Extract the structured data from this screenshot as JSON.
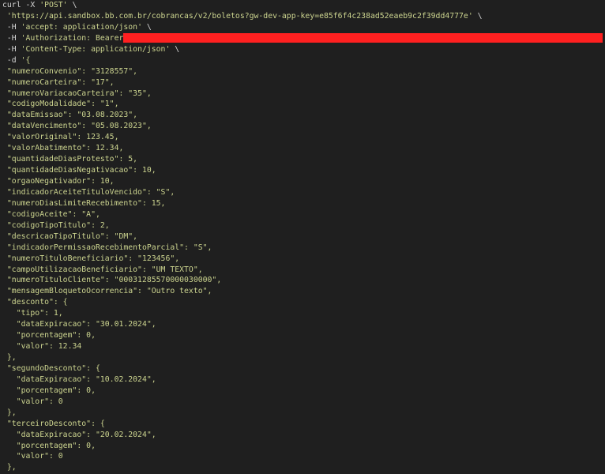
{
  "colors": {
    "background": "#1f1f1f",
    "plain_text": "#d4d4d4",
    "string": "#ccd48f",
    "redaction": "#ff2020"
  },
  "lines": [
    {
      "indent": 0,
      "parts": [
        {
          "t": "curl -X ",
          "c": "w"
        },
        {
          "t": "'POST'",
          "c": "s"
        },
        {
          "t": " \\",
          "c": "w"
        }
      ]
    },
    {
      "indent": 1,
      "parts": [
        {
          "t": "'https://api.sandbox.bb.com.br/cobrancas/v2/boletos?gw-dev-app-key=e85f6f4c238ad52eaeb9c2f39dd4777e'",
          "c": "s"
        },
        {
          "t": " \\",
          "c": "w"
        }
      ]
    },
    {
      "indent": 1,
      "parts": [
        {
          "t": "-H ",
          "c": "w"
        },
        {
          "t": "'accept: application/json'",
          "c": "s"
        },
        {
          "t": " \\",
          "c": "w"
        }
      ]
    },
    {
      "indent": 1,
      "parts": [
        {
          "t": "-H ",
          "c": "w"
        },
        {
          "t": "'Authorization: Bearer ",
          "c": "s"
        }
      ]
    },
    {
      "indent": 1,
      "parts": [
        {
          "t": "-H ",
          "c": "w"
        },
        {
          "t": "'Content-Type: application/json'",
          "c": "s"
        },
        {
          "t": " \\",
          "c": "w"
        }
      ]
    },
    {
      "indent": 1,
      "parts": [
        {
          "t": "-d ",
          "c": "w"
        },
        {
          "t": "'{",
          "c": "s"
        }
      ]
    },
    {
      "indent": 1,
      "parts": [
        {
          "t": "\"numeroConvenio\": \"3128557\",",
          "c": "s"
        }
      ]
    },
    {
      "indent": 1,
      "parts": [
        {
          "t": "\"numeroCarteira\": \"17\",",
          "c": "s"
        }
      ]
    },
    {
      "indent": 1,
      "parts": [
        {
          "t": "\"numeroVariacaoCarteira\": \"35\",",
          "c": "s"
        }
      ]
    },
    {
      "indent": 1,
      "parts": [
        {
          "t": "\"codigoModalidade\": \"1\",",
          "c": "s"
        }
      ]
    },
    {
      "indent": 1,
      "parts": [
        {
          "t": "\"dataEmissao\": \"03.08.2023\",",
          "c": "s"
        }
      ]
    },
    {
      "indent": 1,
      "parts": [
        {
          "t": "\"dataVencimento\": \"05.08.2023\",",
          "c": "s"
        }
      ]
    },
    {
      "indent": 1,
      "parts": [
        {
          "t": "\"valorOriginal\": 123.45,",
          "c": "s"
        }
      ]
    },
    {
      "indent": 1,
      "parts": [
        {
          "t": "\"valorAbatimento\": 12.34,",
          "c": "s"
        }
      ]
    },
    {
      "indent": 1,
      "parts": [
        {
          "t": "\"quantidadeDiasProtesto\": 5,",
          "c": "s"
        }
      ]
    },
    {
      "indent": 1,
      "parts": [
        {
          "t": "\"quantidadeDiasNegativacao\": 10,",
          "c": "s"
        }
      ]
    },
    {
      "indent": 1,
      "parts": [
        {
          "t": "\"orgaoNegativador\": 10,",
          "c": "s"
        }
      ]
    },
    {
      "indent": 1,
      "parts": [
        {
          "t": "\"indicadorAceiteTituloVencido\": \"S\",",
          "c": "s"
        }
      ]
    },
    {
      "indent": 1,
      "parts": [
        {
          "t": "\"numeroDiasLimiteRecebimento\": 15,",
          "c": "s"
        }
      ]
    },
    {
      "indent": 1,
      "parts": [
        {
          "t": "\"codigoAceite\": \"A\",",
          "c": "s"
        }
      ]
    },
    {
      "indent": 1,
      "parts": [
        {
          "t": "\"codigoTipoTitulo\": 2,",
          "c": "s"
        }
      ]
    },
    {
      "indent": 1,
      "parts": [
        {
          "t": "\"descricaoTipoTitulo\": \"DM\",",
          "c": "s"
        }
      ]
    },
    {
      "indent": 1,
      "parts": [
        {
          "t": "\"indicadorPermissaoRecebimentoParcial\": \"S\",",
          "c": "s"
        }
      ]
    },
    {
      "indent": 1,
      "parts": [
        {
          "t": "\"numeroTituloBeneficiario\": \"123456\",",
          "c": "s"
        }
      ]
    },
    {
      "indent": 1,
      "parts": [
        {
          "t": "\"campoUtilizacaoBeneficiario\": \"UM TEXTO\",",
          "c": "s"
        }
      ]
    },
    {
      "indent": 1,
      "parts": [
        {
          "t": "\"numeroTituloCliente\": \"00031285570000030000\",",
          "c": "s"
        }
      ]
    },
    {
      "indent": 1,
      "parts": [
        {
          "t": "\"mensagemBloquetoOcorrencia\": \"Outro texto\",",
          "c": "s"
        }
      ]
    },
    {
      "indent": 1,
      "parts": [
        {
          "t": "\"desconto\": {",
          "c": "s"
        }
      ]
    },
    {
      "indent": 2,
      "parts": [
        {
          "t": "\"tipo\": 1,",
          "c": "s"
        }
      ]
    },
    {
      "indent": 2,
      "parts": [
        {
          "t": "\"dataExpiracao\": \"30.01.2024\",",
          "c": "s"
        }
      ]
    },
    {
      "indent": 2,
      "parts": [
        {
          "t": "\"porcentagem\": 0,",
          "c": "s"
        }
      ]
    },
    {
      "indent": 2,
      "parts": [
        {
          "t": "\"valor\": 12.34",
          "c": "s"
        }
      ]
    },
    {
      "indent": 1,
      "parts": [
        {
          "t": "},",
          "c": "s"
        }
      ]
    },
    {
      "indent": 1,
      "parts": [
        {
          "t": "\"segundoDesconto\": {",
          "c": "s"
        }
      ]
    },
    {
      "indent": 2,
      "parts": [
        {
          "t": "\"dataExpiracao\": \"10.02.2024\",",
          "c": "s"
        }
      ]
    },
    {
      "indent": 2,
      "parts": [
        {
          "t": "\"porcentagem\": 0,",
          "c": "s"
        }
      ]
    },
    {
      "indent": 2,
      "parts": [
        {
          "t": "\"valor\": 0",
          "c": "s"
        }
      ]
    },
    {
      "indent": 1,
      "parts": [
        {
          "t": "},",
          "c": "s"
        }
      ]
    },
    {
      "indent": 1,
      "parts": [
        {
          "t": "\"terceiroDesconto\": {",
          "c": "s"
        }
      ]
    },
    {
      "indent": 2,
      "parts": [
        {
          "t": "\"dataExpiracao\": \"20.02.2024\",",
          "c": "s"
        }
      ]
    },
    {
      "indent": 2,
      "parts": [
        {
          "t": "\"porcentagem\": 0,",
          "c": "s"
        }
      ]
    },
    {
      "indent": 2,
      "parts": [
        {
          "t": "\"valor\": 0",
          "c": "s"
        }
      ]
    },
    {
      "indent": 1,
      "parts": [
        {
          "t": "},",
          "c": "s"
        }
      ]
    }
  ]
}
